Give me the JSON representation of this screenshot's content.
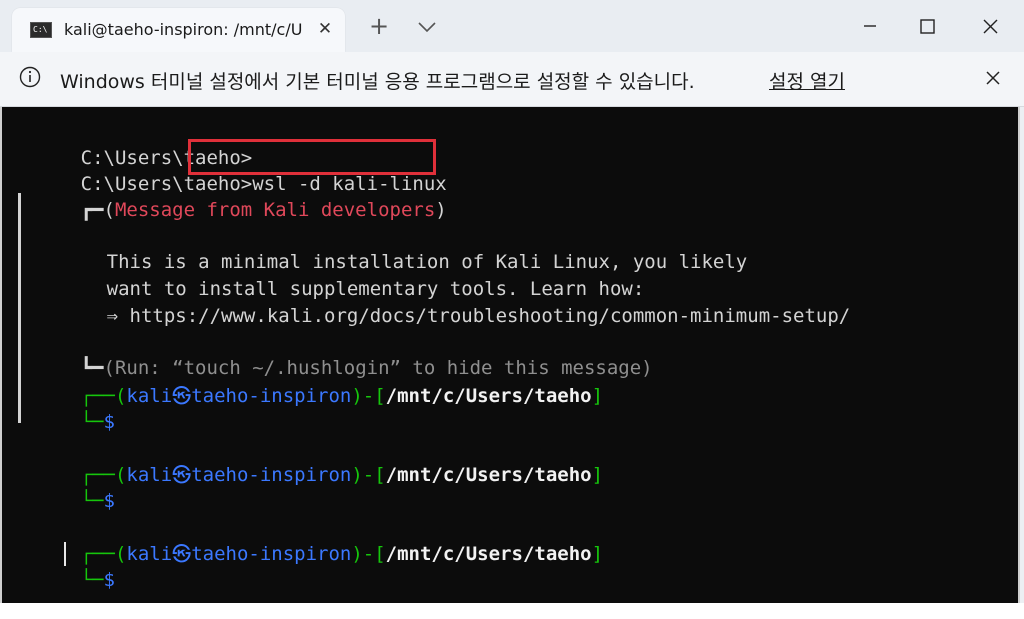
{
  "window": {
    "tab_title": "kali@taeho-inspiron: /mnt/c/U",
    "tab_icon_text": "C:\\",
    "new_tab_symbol": "+",
    "tab_close_symbol": "✕"
  },
  "infobar": {
    "message": "Windows 터미널 설정에서 기본 터미널 응용 프로그램으로 설정할 수 있습니다.",
    "link_label": "설정 열기"
  },
  "terminal": {
    "lines": {
      "l1": "C:\\Users\\taeho>",
      "l2_prompt": "C:\\Users\\taeho>",
      "l2_cmd": "wsl -d kali-linux",
      "msg_head_box": "┏━(",
      "msg_title": "Message from Kali developers",
      "msg_head_close": ")",
      "msg_1": "This is a minimal installation of Kali Linux, you likely",
      "msg_2": "want to install supplementary tools. Learn how:",
      "msg_3_arrow": "⇒",
      "msg_3_url": "https://www.kali.org/docs/troubleshooting/common-minimum-setup/",
      "msg_tail_box": "┗━",
      "msg_tail": "(Run: “touch ~/.hushlogin” to hide this message)",
      "prompt_user": "kali",
      "prompt_at": "㉿",
      "prompt_host": "taeho-inspiron",
      "prompt_path": "/mnt/c/Users/taeho",
      "prompt_dollar": "$"
    }
  },
  "colors": {
    "terminal_bg": "#0c0c0c",
    "prompt_green": "#16c60c",
    "prompt_blue": "#3b78ff",
    "message_red": "#e0485a",
    "highlight_red": "#e0303a"
  }
}
